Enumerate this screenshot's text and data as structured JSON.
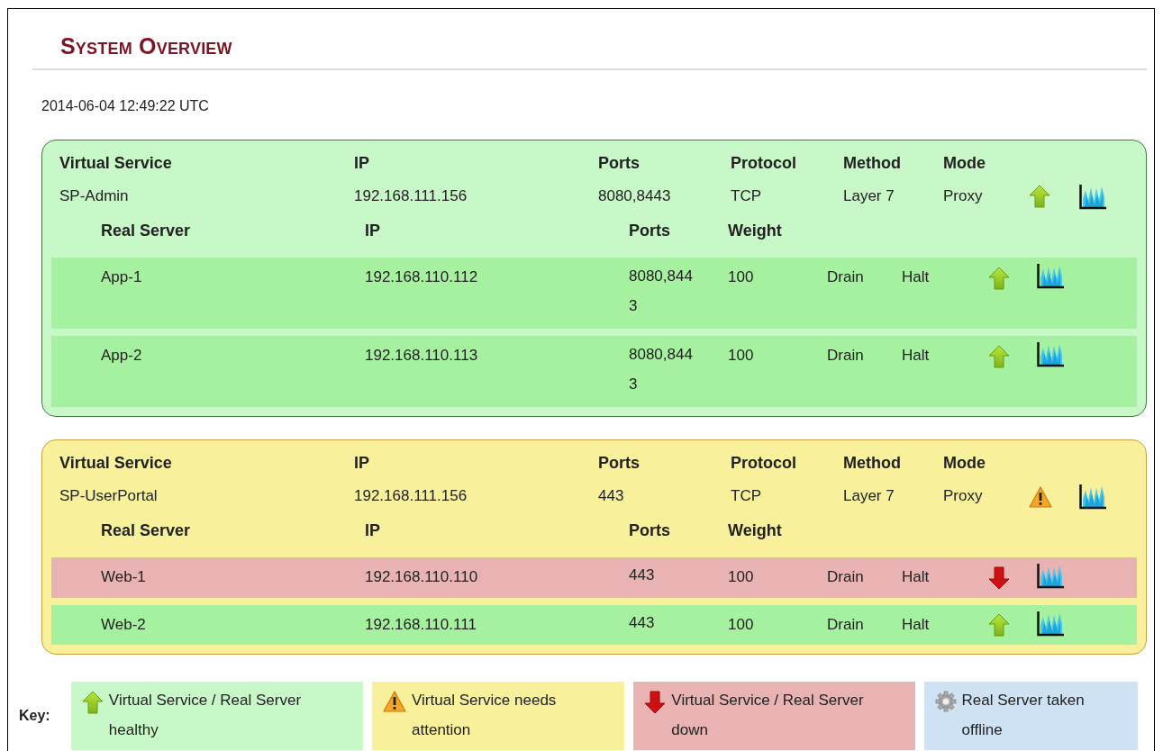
{
  "title": "System Overview",
  "timestamp": "2014-06-04 12:49:22 UTC",
  "services": [
    {
      "columns": [
        "Virtual Service",
        "IP",
        "Ports",
        "Protocol",
        "Method",
        "Mode"
      ],
      "name": "SP-Admin",
      "ip": "192.168.111.156",
      "ports": "8080,8443",
      "protocol": "TCP",
      "method": "Layer 7",
      "mode": "Proxy",
      "kind": "healthy",
      "server_columns": [
        "Real Server",
        "IP",
        "Ports",
        "Weight"
      ],
      "servers": [
        {
          "name": "App-1",
          "ip": "192.168.110.112",
          "ports": "8080,8443",
          "weight": "100",
          "drain": "Drain",
          "halt": "Halt",
          "kind": "up"
        },
        {
          "name": "App-2",
          "ip": "192.168.110.113",
          "ports": "8080,8443",
          "weight": "100",
          "drain": "Drain",
          "halt": "Halt",
          "kind": "up"
        }
      ]
    },
    {
      "columns": [
        "Virtual Service",
        "IP",
        "Ports",
        "Protocol",
        "Method",
        "Mode"
      ],
      "name": "SP-UserPortal",
      "ip": "192.168.111.156",
      "ports": "443",
      "protocol": "TCP",
      "method": "Layer 7",
      "mode": "Proxy",
      "kind": "warning",
      "server_columns": [
        "Real Server",
        "IP",
        "Ports",
        "Weight"
      ],
      "servers": [
        {
          "name": "Web-1",
          "ip": "192.168.110.110",
          "ports": "443",
          "weight": "100",
          "drain": "Drain",
          "halt": "Halt",
          "kind": "down"
        },
        {
          "name": "Web-2",
          "ip": "192.168.110.111",
          "ports": "443",
          "weight": "100",
          "drain": "Drain",
          "halt": "Halt",
          "kind": "up"
        }
      ]
    }
  ],
  "key": {
    "label": "Key:",
    "items": [
      {
        "kind": "healthy",
        "text": "Virtual Service / Real Server healthy"
      },
      {
        "kind": "warning",
        "text": "Virtual Service needs attention"
      },
      {
        "kind": "down",
        "text": "Virtual Service / Real Server down"
      },
      {
        "kind": "offline",
        "text": "Real Server taken offline"
      }
    ]
  }
}
